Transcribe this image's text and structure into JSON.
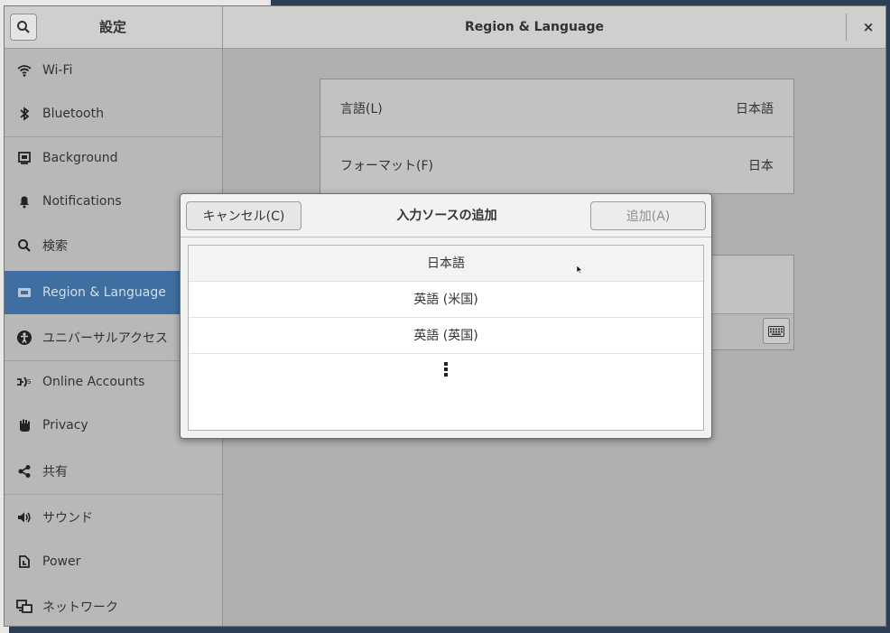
{
  "titlebar": {
    "app_title": "設定",
    "window_title": "Region & Language",
    "close_label": "×"
  },
  "sidebar": {
    "items": [
      {
        "label": "Wi-Fi",
        "icon": "wifi-icon"
      },
      {
        "label": "Bluetooth",
        "icon": "bluetooth-icon"
      },
      {
        "label": "Background",
        "icon": "background-icon"
      },
      {
        "label": "Notifications",
        "icon": "bell-icon"
      },
      {
        "label": "検索",
        "icon": "search-icon"
      },
      {
        "label": "Region & Language",
        "icon": "region-icon",
        "active": true
      },
      {
        "label": "ユニバーサルアクセス",
        "icon": "accessibility-icon"
      },
      {
        "label": "Online Accounts",
        "icon": "online-accounts-icon"
      },
      {
        "label": "Privacy",
        "icon": "hand-icon"
      },
      {
        "label": "共有",
        "icon": "share-icon"
      },
      {
        "label": "サウンド",
        "icon": "speaker-icon"
      },
      {
        "label": "Power",
        "icon": "power-icon"
      },
      {
        "label": "ネットワーク",
        "icon": "network-icon"
      }
    ]
  },
  "main": {
    "language_label": "言語(L)",
    "language_value": "日本語",
    "format_label": "フォーマット(F)",
    "format_value": "日本"
  },
  "dialog": {
    "title": "入力ソースの追加",
    "cancel_label": "キャンセル(C)",
    "add_label": "追加(A)",
    "items": [
      "日本語",
      "英語 (米国)",
      "英語 (英国)"
    ]
  },
  "colors": {
    "active_item": "#3f6fa1",
    "dialog_bg": "#f2f2f1",
    "add_button_text_disabled": "#8d8f8c"
  }
}
